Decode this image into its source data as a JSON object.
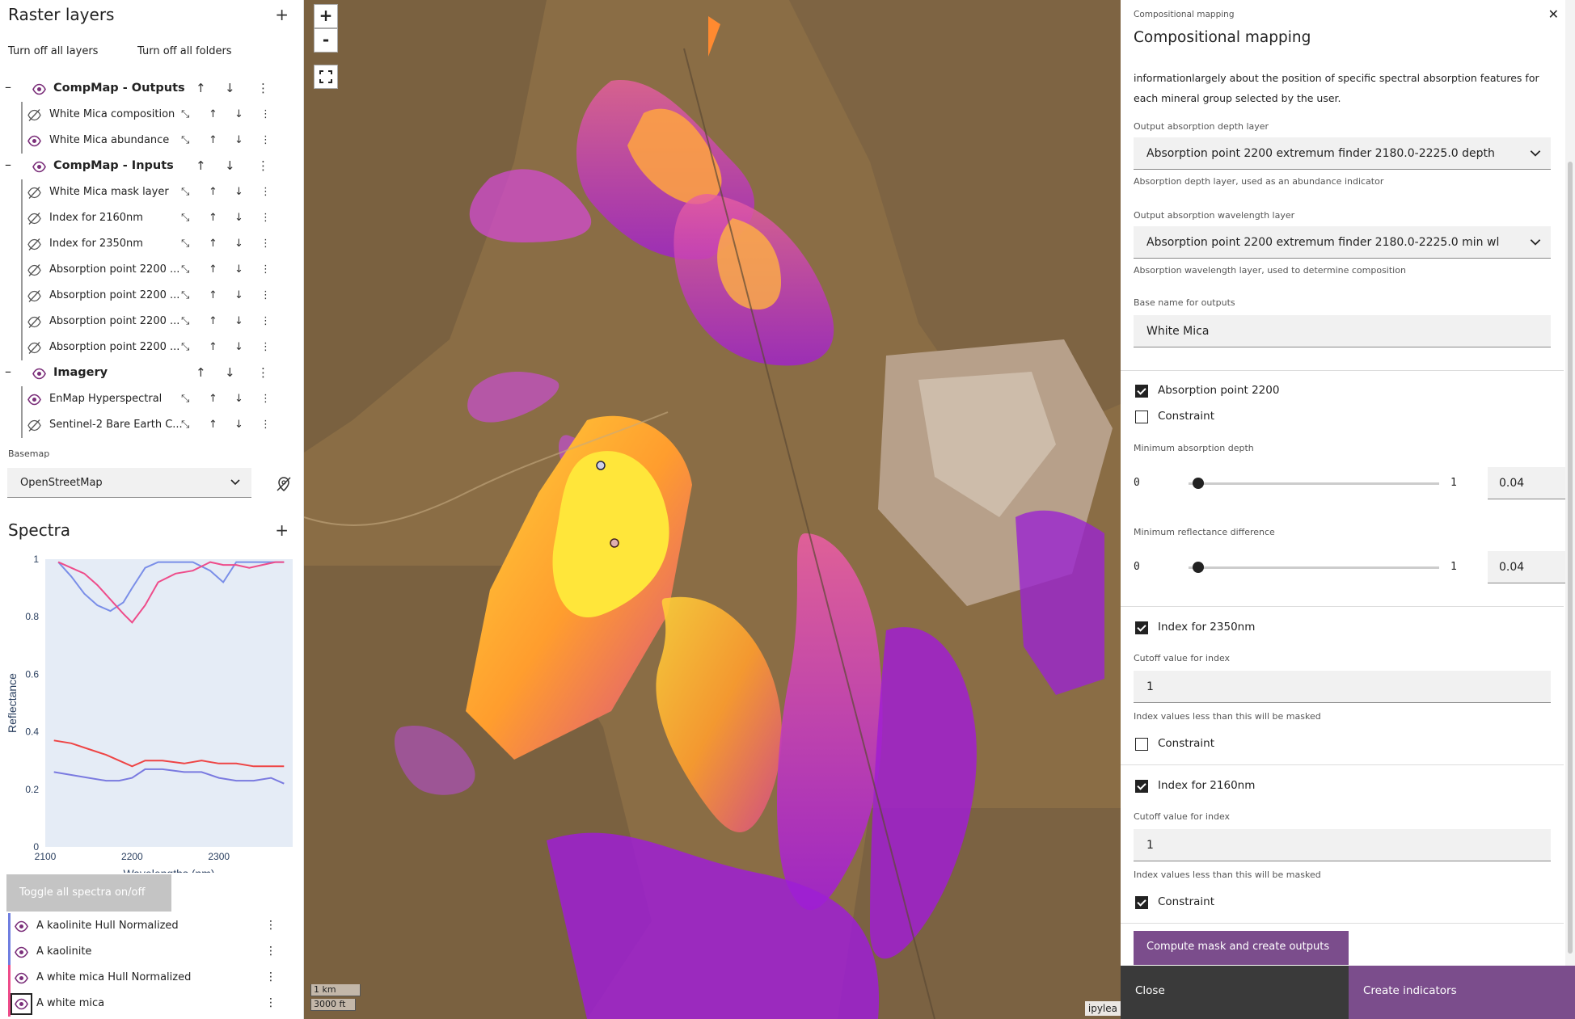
{
  "left": {
    "raster_title": "Raster layers",
    "add_symbol": "+",
    "turn_off_layers": "Turn off all layers",
    "turn_off_folders": "Turn off all folders",
    "folders": [
      {
        "name": "CompMap - Outputs",
        "layers": [
          "White Mica composition",
          "White Mica abundance"
        ]
      },
      {
        "name": "CompMap - Inputs",
        "layers": [
          "White Mica mask layer",
          "Index for 2160nm",
          "Index for 2350nm",
          "Absorption point 2200 ...",
          "Absorption point 2200 ...",
          "Absorption point 2200 ...",
          "Absorption point 2200 ..."
        ]
      },
      {
        "name": "Imagery",
        "layers": [
          "EnMap Hyperspectral",
          "Sentinel-2 Bare Earth C..."
        ]
      }
    ],
    "basemap_label": "Basemap",
    "basemap_value": "OpenStreetMap",
    "spectra_title": "Spectra",
    "toggle_spectra": "Toggle all spectra on/off",
    "spectra": [
      {
        "name": "A kaolinite Hull Normalized",
        "color": "#6f7ee0"
      },
      {
        "name": "A kaolinite",
        "color": "#6f7ee0"
      },
      {
        "name": "A white mica Hull Normalized",
        "color": "#ee4c8a"
      },
      {
        "name": "A white mica",
        "color": "#ee4c8a"
      }
    ]
  },
  "chart_data": {
    "type": "line",
    "xlabel": "Wavelengths (nm)",
    "ylabel": "Reflectance",
    "xlim": [
      2100,
      2385
    ],
    "ylim": [
      0,
      1
    ],
    "xticks": [
      2100,
      2200,
      2300
    ],
    "yticks": [
      0,
      0.2,
      0.4,
      0.6,
      0.8,
      1
    ],
    "grid": false,
    "series": [
      {
        "color": "#7a8ee8",
        "x": [
          2115,
          2130,
          2145,
          2160,
          2175,
          2190,
          2200,
          2215,
          2230,
          2250,
          2270,
          2290,
          2305,
          2320,
          2335,
          2350,
          2365,
          2375
        ],
        "y": [
          0.99,
          0.94,
          0.88,
          0.84,
          0.82,
          0.85,
          0.9,
          0.97,
          0.99,
          0.99,
          0.99,
          0.96,
          0.92,
          0.99,
          0.99,
          0.99,
          0.99,
          0.99
        ]
      },
      {
        "color": "#ee4c8a",
        "x": [
          2115,
          2130,
          2145,
          2160,
          2175,
          2190,
          2200,
          2215,
          2230,
          2250,
          2270,
          2290,
          2305,
          2320,
          2335,
          2350,
          2365,
          2375
        ],
        "y": [
          0.99,
          0.97,
          0.95,
          0.91,
          0.86,
          0.81,
          0.78,
          0.84,
          0.92,
          0.95,
          0.96,
          0.99,
          0.98,
          0.98,
          0.97,
          0.98,
          0.99,
          0.99
        ]
      },
      {
        "color": "#ee4444",
        "x": [
          2110,
          2130,
          2150,
          2170,
          2185,
          2200,
          2215,
          2235,
          2260,
          2280,
          2300,
          2320,
          2340,
          2360,
          2375
        ],
        "y": [
          0.37,
          0.36,
          0.34,
          0.32,
          0.3,
          0.28,
          0.3,
          0.3,
          0.29,
          0.3,
          0.29,
          0.29,
          0.28,
          0.28,
          0.28
        ]
      },
      {
        "color": "#7a7ae0",
        "x": [
          2110,
          2130,
          2150,
          2170,
          2185,
          2200,
          2215,
          2235,
          2260,
          2280,
          2300,
          2320,
          2340,
          2360,
          2375
        ],
        "y": [
          0.26,
          0.25,
          0.24,
          0.23,
          0.23,
          0.24,
          0.27,
          0.27,
          0.26,
          0.26,
          0.24,
          0.23,
          0.23,
          0.24,
          0.22
        ]
      }
    ]
  },
  "map": {
    "zoom_in": "+",
    "zoom_out": "-",
    "scale_km": "1 km",
    "scale_ft": "3000 ft",
    "attribution": "ipylea"
  },
  "right": {
    "breadcrumb": "Compositional mapping",
    "title": "Compositional mapping",
    "close_icon": "✕",
    "description": "informationlargely about the position of specific spectral absorption features for each mineral group selected by the user.",
    "depth_label": "Output absorption depth layer",
    "depth_value": "Absorption point 2200 extremum finder 2180.0-2225.0 depth",
    "depth_help": "Absorption depth layer, used as an abundance indicator",
    "wl_label": "Output absorption wavelength layer",
    "wl_value": "Absorption point 2200 extremum finder 2180.0-2225.0 min wl",
    "wl_help": "Absorption wavelength layer, used to determine composition",
    "base_label": "Base name for outputs",
    "base_value": "White Mica",
    "abs_check": "Absorption point 2200",
    "constraint": "Constraint",
    "min_depth_label": "Minimum absorption depth",
    "min_refl_label": "Minimum reflectance difference",
    "slider_min": "0",
    "slider_max": "1",
    "slider_value": "0.04",
    "slider_fraction": 0.04,
    "idx2350": "Index for 2350nm",
    "idx2160": "Index for 2160nm",
    "cutoff_label": "Cutoff value for index",
    "cutoff_value": "1",
    "cutoff_help": "Index values less than this will be masked",
    "compute_btn": "Compute mask and create outputs",
    "close_btn": "Close",
    "create_btn": "Create indicators"
  }
}
